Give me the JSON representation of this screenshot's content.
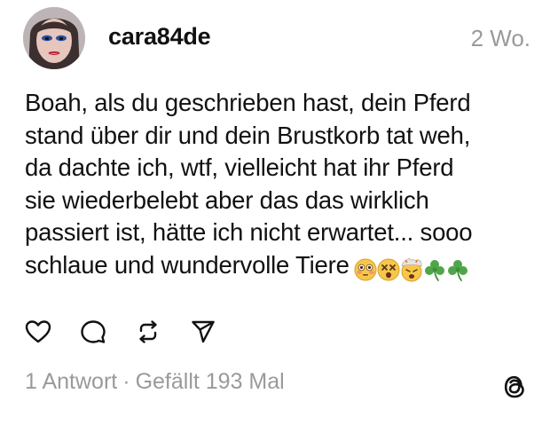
{
  "post": {
    "username": "cara84de",
    "timestamp": "2 Wo.",
    "body_lines": [
      "Boah, als du geschrieben hast, dein Pferd",
      "stand über dir und dein Brustkorb tat weh,",
      "da dachte ich, wtf, vielleicht hat ihr Pferd",
      "sie wiederbelebt aber das das wirklich",
      "passiert ist, hätte ich nicht erwartet... sooo",
      "schlaue und wundervolle Tiere"
    ],
    "emojis": [
      "flushed-face",
      "dizzy-face",
      "exploding-head",
      "shamrock",
      "shamrock"
    ]
  },
  "actions": {
    "icons": [
      "heart-icon",
      "comment-icon",
      "repost-icon",
      "share-icon"
    ]
  },
  "stats": {
    "replies": "1 Antwort",
    "separator": "·",
    "likes": "Gefällt 193 Mal"
  },
  "branding": {
    "logo": "threads-logo-icon"
  }
}
